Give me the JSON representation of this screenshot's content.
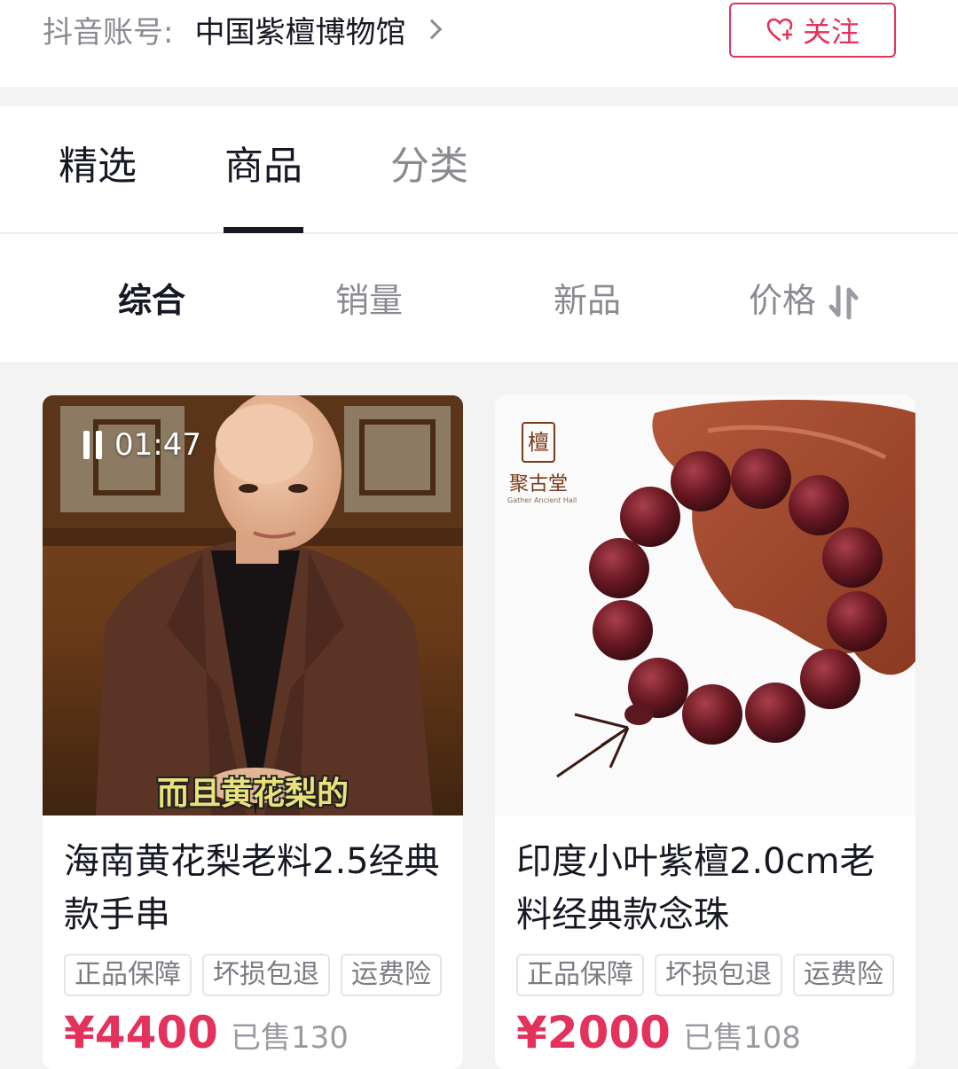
{
  "header": {
    "account_label": "抖音账号:",
    "account_name": "中国紫檀博物馆",
    "follow_label": "关注",
    "accent_color": "#e3325c"
  },
  "tabs": [
    {
      "label": "精选",
      "active": false
    },
    {
      "label": "商品",
      "active": true
    },
    {
      "label": "分类",
      "active": false
    }
  ],
  "sort": [
    {
      "label": "综合",
      "active": true
    },
    {
      "label": "销量",
      "active": false
    },
    {
      "label": "新品",
      "active": false
    },
    {
      "label": "价格",
      "active": false,
      "icon": "sort-arrows-icon"
    }
  ],
  "products": [
    {
      "title": "海南黄花梨老料2.5经典款手串",
      "video_time": "01:47",
      "subtitle": "而且黄花梨的",
      "badges": [
        "正品保障",
        "坏损包退",
        "运费险"
      ],
      "price": "¥4400",
      "sold": "已售130"
    },
    {
      "title": "印度小叶紫檀2.0cm老料经典款念珠",
      "brand_seal": "檀",
      "brand_name": "聚古堂",
      "brand_sub": "Gather Ancient Hall",
      "badges": [
        "正品保障",
        "坏损包退",
        "运费险"
      ],
      "price": "¥2000",
      "sold": "已售108"
    }
  ]
}
